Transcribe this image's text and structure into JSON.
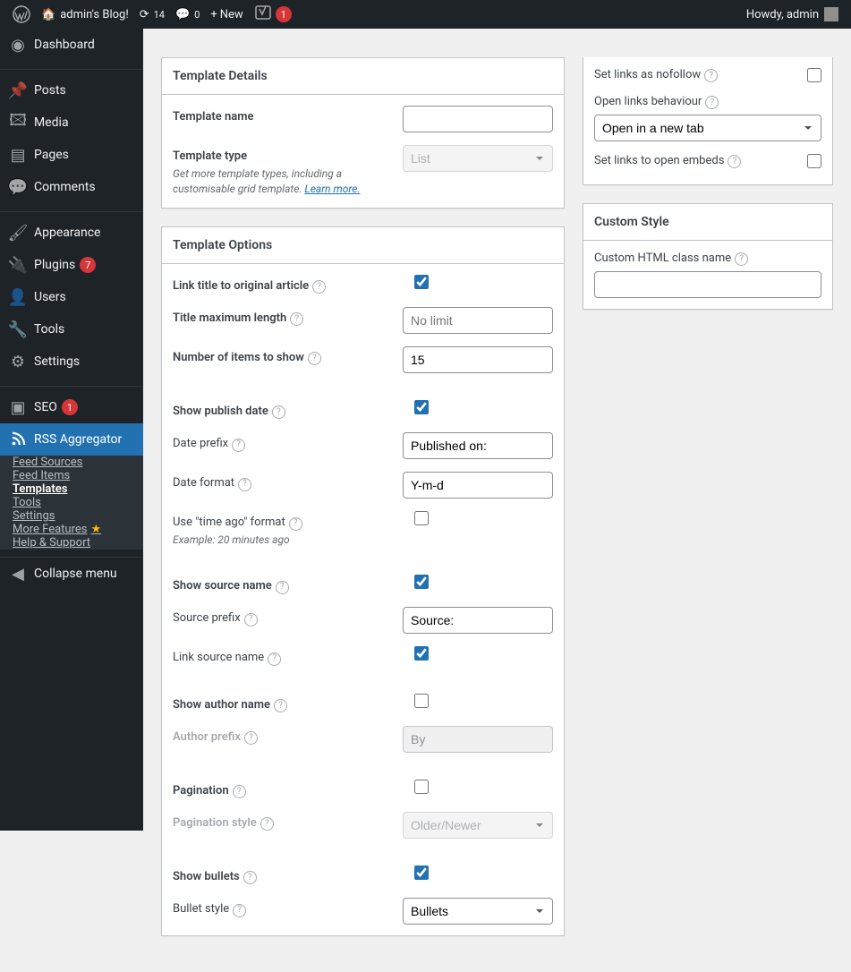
{
  "adminbar": {
    "site": "admin's Blog!",
    "updates": "14",
    "comments": "0",
    "new": "New",
    "yoast_badge": "1",
    "greeting": "Howdy, admin"
  },
  "sidebar": {
    "dashboard": "Dashboard",
    "posts": "Posts",
    "media": "Media",
    "pages": "Pages",
    "comments": "Comments",
    "appearance": "Appearance",
    "plugins": "Plugins",
    "plugins_badge": "7",
    "users": "Users",
    "tools": "Tools",
    "settings": "Settings",
    "seo": "SEO",
    "seo_badge": "1",
    "rss": "RSS Aggregator",
    "sub": {
      "feed_sources": "Feed Sources",
      "feed_items": "Feed Items",
      "templates": "Templates",
      "tools": "Tools",
      "settings": "Settings",
      "more": "More Features",
      "help": "Help & Support"
    },
    "collapse": "Collapse menu"
  },
  "details": {
    "heading": "Template Details",
    "name_label": "Template name",
    "type_label": "Template type",
    "type_value": "List",
    "type_note": "Get more template types, including a customisable grid template. ",
    "learn_more": "Learn more."
  },
  "options": {
    "heading": "Template Options",
    "link_title": "Link title to original article",
    "title_max": "Title maximum length",
    "title_max_ph": "No limit",
    "num_items": "Number of items to show",
    "num_items_val": "15",
    "show_publish": "Show publish date",
    "date_prefix_lbl": "Date prefix",
    "date_prefix_val": "Published on:",
    "date_format_lbl": "Date format",
    "date_format_val": "Y-m-d",
    "time_ago": "Use \"time ago\" format",
    "time_ago_note": "Example: 20 minutes ago",
    "show_source": "Show source name",
    "source_prefix_lbl": "Source prefix",
    "source_prefix_val": "Source:",
    "link_source": "Link source name",
    "show_author": "Show author name",
    "author_prefix_lbl": "Author prefix",
    "author_prefix_val": "By",
    "pagination": "Pagination",
    "pagination_style_lbl": "Pagination style",
    "pagination_style_val": "Older/Newer",
    "show_bullets": "Show bullets",
    "bullet_style_lbl": "Bullet style",
    "bullet_style_val": "Bullets"
  },
  "side1": {
    "nofollow": "Set links as nofollow",
    "open_behaviour": "Open links behaviour",
    "open_val": "Open in a new tab",
    "open_embeds": "Set links to open embeds"
  },
  "side2": {
    "heading": "Custom Style",
    "html_class": "Custom HTML class name"
  }
}
